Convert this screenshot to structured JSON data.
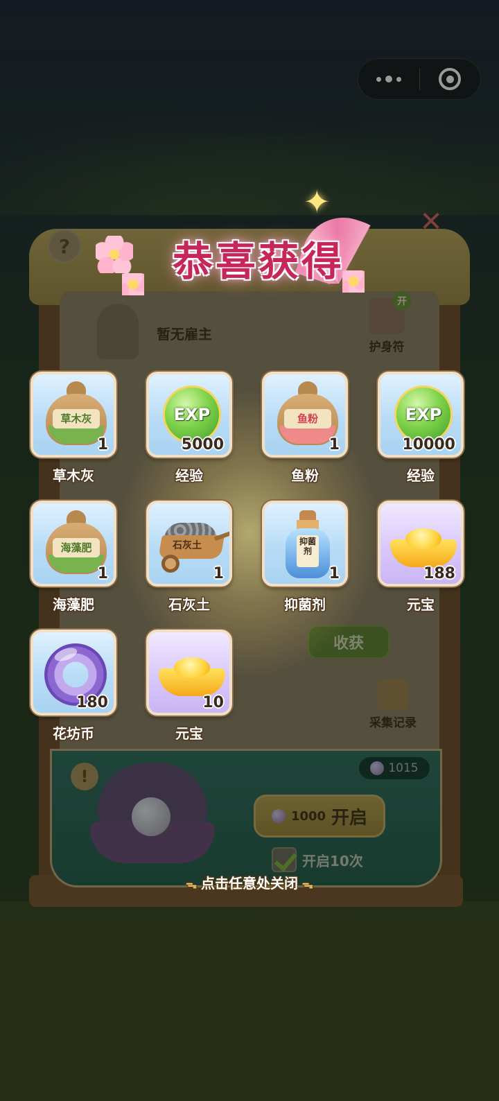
{
  "capsule": {
    "more_icon": "more-dots-icon",
    "close_icon": "target-circle-icon"
  },
  "background": {
    "help_label": "?",
    "employer_status": "暂无雇主",
    "amulet_badge": "开",
    "amulet_label": "护身符",
    "harvest_button": "收获",
    "collect_record_label": "采集记录",
    "warning_label": "!",
    "pearl_balance": "1015",
    "open_cost": "1000",
    "open_label": "开启",
    "open_ten_label": "开启10次",
    "open_ten_checked": true
  },
  "title": "恭喜获得",
  "rewards": [
    {
      "name": "草木灰",
      "quantity": "1",
      "icon": "fertilizer-sack-icon",
      "tag": "草木灰",
      "style": "green"
    },
    {
      "name": "经验",
      "quantity": "5000",
      "icon": "exp-orb-icon",
      "tag": "EXP",
      "style": "exp"
    },
    {
      "name": "鱼粉",
      "quantity": "1",
      "icon": "fertilizer-sack-icon",
      "tag": "鱼粉",
      "style": "pink"
    },
    {
      "name": "经验",
      "quantity": "10000",
      "icon": "exp-orb-icon",
      "tag": "EXP",
      "style": "exp"
    },
    {
      "name": "海藻肥",
      "quantity": "1",
      "icon": "fertilizer-sack-icon",
      "tag": "海藻肥",
      "style": "green"
    },
    {
      "name": "石灰土",
      "quantity": "1",
      "icon": "lime-cart-icon",
      "tag": "石灰土",
      "style": "cart"
    },
    {
      "name": "抑菌剂",
      "quantity": "1",
      "icon": "antibacterial-bottle-icon",
      "tag": "抑菌剂",
      "style": "bottle"
    },
    {
      "name": "元宝",
      "quantity": "188",
      "icon": "gold-ingot-icon",
      "tag": "",
      "style": "ingot"
    },
    {
      "name": "花坊币",
      "quantity": "180",
      "icon": "flower-shop-coin-icon",
      "tag": "",
      "style": "coin"
    },
    {
      "name": "元宝",
      "quantity": "10",
      "icon": "gold-ingot-icon",
      "tag": "",
      "style": "ingot"
    }
  ],
  "close_hint": "点击任意处关闭"
}
